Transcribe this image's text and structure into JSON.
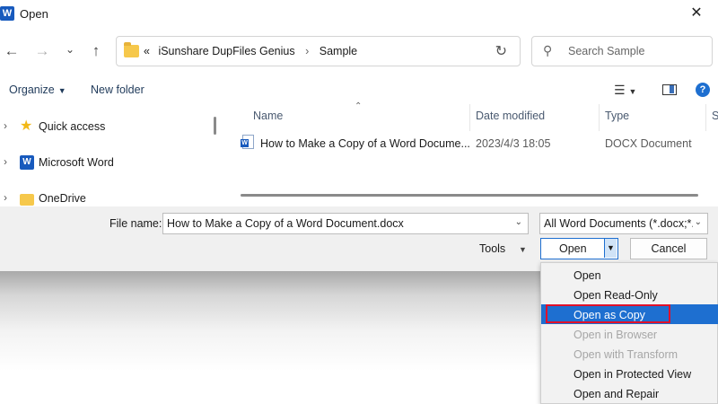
{
  "window": {
    "title": "Open",
    "app_icon": "W"
  },
  "nav": {
    "back": "←",
    "forward": "→",
    "recent": "⌄",
    "up": "↑"
  },
  "address": {
    "prefix": "«",
    "crumbs": [
      "iSunshare DupFiles Genius",
      "Sample"
    ],
    "separator": "›"
  },
  "search": {
    "placeholder": "Search Sample"
  },
  "toolbar": {
    "organize": "Organize",
    "new_folder": "New folder",
    "help": "?"
  },
  "sidebar": {
    "items": [
      {
        "label": "Quick access",
        "icon": "star-icon"
      },
      {
        "label": "Microsoft Word",
        "icon": "word-icon"
      },
      {
        "label": "OneDrive",
        "icon": "onedrive-folder-icon"
      }
    ]
  },
  "filelist": {
    "columns": [
      "Name",
      "Date modified",
      "Type",
      "S"
    ],
    "rows": [
      {
        "name": "How to Make a Copy of a Word Docume...",
        "date": "2023/4/3 18:05",
        "type": "DOCX Document"
      }
    ]
  },
  "bottom": {
    "filename_label": "File name:",
    "filename_value": "How to Make a Copy of a Word Document.docx",
    "filetype_value": "All Word Documents (*.docx;*.d",
    "tools_label": "Tools",
    "open_label": "Open",
    "cancel_label": "Cancel"
  },
  "open_menu": {
    "items": [
      {
        "label": "Open",
        "enabled": true
      },
      {
        "label": "Open Read-Only",
        "enabled": true
      },
      {
        "label": "Open as Copy",
        "enabled": true,
        "selected": true
      },
      {
        "label": "Open in Browser",
        "enabled": false
      },
      {
        "label": "Open with Transform",
        "enabled": false
      },
      {
        "label": "Open in Protected View",
        "enabled": true
      },
      {
        "label": "Open and Repair",
        "enabled": true
      }
    ]
  },
  "colors": {
    "accent": "#1e6fd0",
    "highlight_border": "#e0102a",
    "word_blue": "#185abd"
  }
}
